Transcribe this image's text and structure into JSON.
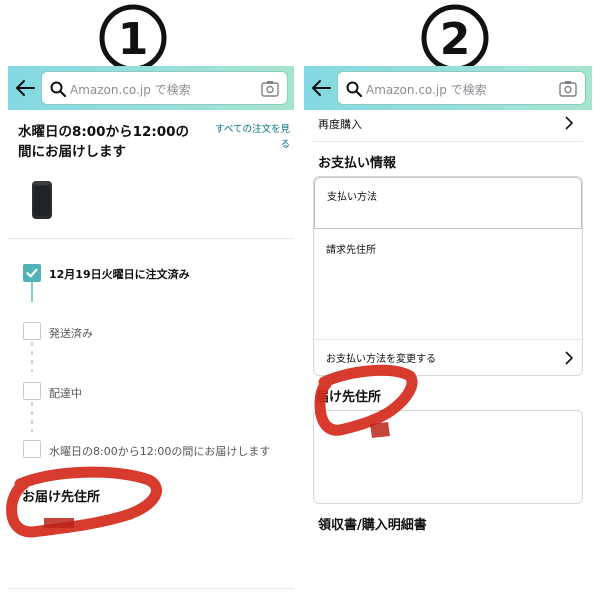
{
  "markers": [
    "①",
    "②"
  ],
  "search": {
    "placeholder": "Amazon.co.jp で検索"
  },
  "left_panel": {
    "delivery_title": "水曜日の8:00から12:00の間にお届けします",
    "all_orders_link": "すべての注文を見る",
    "steps": [
      {
        "label": "12月19日火曜日に注文済み",
        "done": true
      },
      {
        "label": "発送済み",
        "done": false
      },
      {
        "label": "配達中",
        "done": false
      },
      {
        "label": "水曜日の8:00から12:00の間にお届けします",
        "done": false
      }
    ],
    "delivery_address_title": "お届け先住所"
  },
  "right_panel": {
    "rebuy_label": "再度購入",
    "payment_info_title": "お支払い情報",
    "payment_method_label": "支払い方法",
    "billing_address_label": "請求先住所",
    "change_payment_label": "お支払い方法を変更する",
    "delivery_address_title": "届け先住所",
    "receipt_title": "領収書/購入明細書"
  },
  "colors": {
    "header_from": "#84d8e3",
    "header_to": "#a6e6cf",
    "scribble": "#d42a1c",
    "link": "#007185",
    "check": "#4fb3b8"
  }
}
